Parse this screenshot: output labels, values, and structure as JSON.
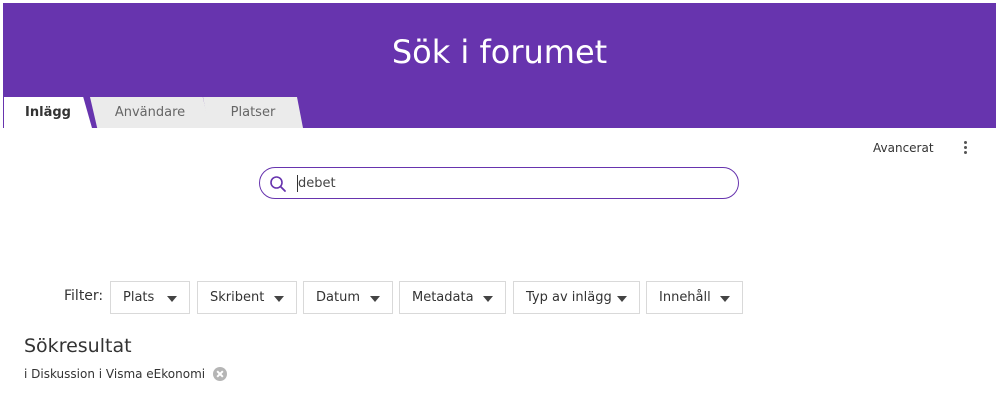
{
  "hero": {
    "title": "Sök i forumet"
  },
  "tabs": [
    {
      "label": "Inlägg",
      "active": true
    },
    {
      "label": "Användare",
      "active": false
    },
    {
      "label": "Platser",
      "active": false
    }
  ],
  "toolbar": {
    "advanced_label": "Avancerat",
    "more_icon": "kebab-icon"
  },
  "search": {
    "value": "debet",
    "icon": "search-icon"
  },
  "filters": {
    "label": "Filter:",
    "items": [
      {
        "label": "Plats"
      },
      {
        "label": "Skribent"
      },
      {
        "label": "Datum"
      },
      {
        "label": "Metadata"
      },
      {
        "label": "Typ av inlägg"
      },
      {
        "label": "Innehåll"
      }
    ]
  },
  "results": {
    "title": "Sökresultat",
    "scope_text": "i Diskussion i Visma eEkonomi"
  },
  "colors": {
    "brand": "#6734ae",
    "tab_inactive": "#ebebeb"
  }
}
